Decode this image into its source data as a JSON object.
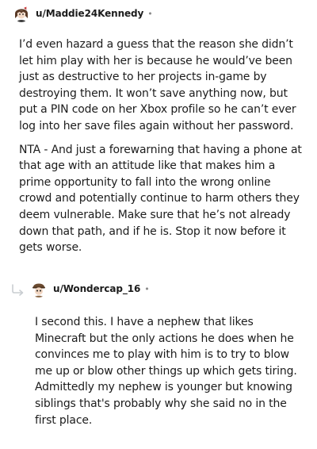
{
  "comments": [
    {
      "username": "u/Maddie24Kennedy",
      "separator": "•",
      "paragraphs": [
        "I’d even hazard a guess that the reason she didn’t let him play with her is because he would’ve been just as destructive to her projects in-game by destroying them. It won’t save anything now, but put a PIN code on her Xbox profile so he can’t ever log into her save files again without her password.",
        "NTA - And just a forewarning that having a phone at that age with an attitude like that makes him a prime opportunity to fall into the wrong online crowd and potentially continue to harm others they deem vulnerable. Make sure that he’s not already down that path, and if he is. Stop it now before it gets worse."
      ],
      "avatar_icon": "reddit-avatar-brown-hair"
    },
    {
      "username": "u/Wondercap_16",
      "separator": "•",
      "paragraphs": [
        "I second this. I have a nephew that likes Minecraft but the only actions he does when he convinces me to play with him is to try to blow me up or blow other things up which gets tiring. Admittedly my nephew is younger but knowing siblings that's probably why she said no in the first place."
      ],
      "avatar_icon": "reddit-avatar-brown-hat",
      "reply_icon": "reply-arrow-icon"
    }
  ],
  "colors": {
    "text": "#1c1c1c",
    "meta": "#8a8a8a",
    "reply_arrow": "#c9cdd1"
  }
}
